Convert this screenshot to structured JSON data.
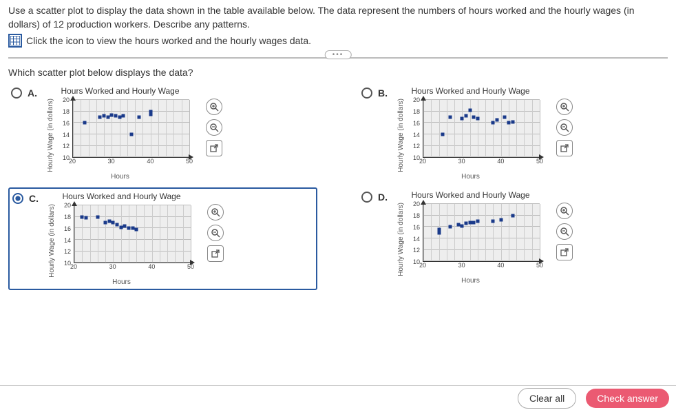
{
  "question": {
    "line1": "Use a scatter plot to display the data shown in the table available below. The data represent the numbers of hours worked and the hourly wages (in dollars) of 12 production workers. Describe any patterns.",
    "icon_line": "Click the icon to view the hours worked and the hourly wages data."
  },
  "sub_question": "Which scatter plot below displays the data?",
  "options": [
    {
      "id": "A",
      "label": "A.",
      "selected": false
    },
    {
      "id": "B",
      "label": "B.",
      "selected": false
    },
    {
      "id": "C",
      "label": "C.",
      "selected": true
    },
    {
      "id": "D",
      "label": "D.",
      "selected": false
    }
  ],
  "chart_common": {
    "title": "Hours Worked and Hourly Wage",
    "xlabel": "Hours",
    "ylabel": "Hourly Wage (in dollars)",
    "xticks": [
      20,
      30,
      40,
      50
    ],
    "yticks": [
      10,
      12,
      14,
      16,
      18,
      20
    ],
    "xlim": [
      20,
      50
    ],
    "ylim": [
      10,
      20
    ]
  },
  "chart_data": [
    {
      "type": "scatter",
      "option": "A",
      "title": "Hours Worked and Hourly Wage",
      "xlabel": "Hours",
      "ylabel": "Hourly Wage (in dollars)",
      "xlim": [
        20,
        50
      ],
      "ylim": [
        10,
        20
      ],
      "x": [
        23,
        27,
        28,
        29,
        30,
        31,
        32,
        33,
        35,
        37,
        40,
        40
      ],
      "y": [
        16,
        17,
        17.2,
        17,
        17.4,
        17.3,
        17,
        17.2,
        14,
        17,
        17.5,
        18
      ]
    },
    {
      "type": "scatter",
      "option": "B",
      "title": "Hours Worked and Hourly Wage",
      "xlabel": "Hours",
      "ylabel": "Hourly Wage (in dollars)",
      "xlim": [
        20,
        50
      ],
      "ylim": [
        10,
        20
      ],
      "x": [
        25,
        27,
        30,
        31,
        32,
        33,
        34,
        38,
        39,
        41,
        42,
        43
      ],
      "y": [
        14,
        17,
        16.8,
        17.2,
        18.2,
        17,
        16.8,
        16,
        16.5,
        17,
        16,
        16.2
      ]
    },
    {
      "type": "scatter",
      "option": "C",
      "title": "Hours Worked and Hourly Wage",
      "xlabel": "Hours",
      "ylabel": "Hourly Wage (in dollars)",
      "xlim": [
        20,
        50
      ],
      "ylim": [
        10,
        20
      ],
      "x": [
        22,
        23,
        26,
        28,
        29,
        30,
        31,
        32,
        33,
        34,
        35,
        36
      ],
      "y": [
        18,
        17.8,
        18,
        17,
        17.2,
        17,
        16.6,
        16.2,
        16.4,
        16,
        16,
        15.8
      ]
    },
    {
      "type": "scatter",
      "option": "D",
      "title": "Hours Worked and Hourly Wage",
      "xlabel": "Hours",
      "ylabel": "Hourly Wage (in dollars)",
      "xlim": [
        20,
        50
      ],
      "ylim": [
        10,
        20
      ],
      "x": [
        24,
        24,
        27,
        29,
        30,
        31,
        32,
        33,
        34,
        38,
        40,
        43
      ],
      "y": [
        15,
        15.6,
        16,
        16.4,
        16.2,
        16.6,
        16.8,
        16.8,
        17,
        17,
        17.2,
        18
      ]
    }
  ],
  "tools": {
    "zoom_in": "⚲",
    "zoom_out": "⚲",
    "popout": "⇱"
  },
  "buttons": {
    "clear": "Clear all",
    "check": "Check answer"
  }
}
